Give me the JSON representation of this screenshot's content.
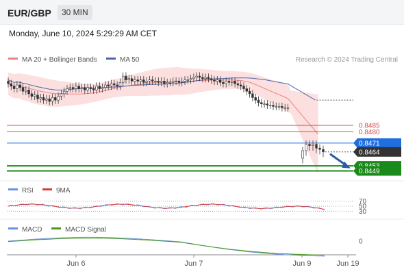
{
  "header": {
    "pair": "EUR/GBP",
    "timeframe": "30 MIN",
    "datetime": "Monday, June 10, 2024 5:29:29 AM CET"
  },
  "legend": {
    "ma20": "MA 20 + Bollinger Bands",
    "ma50": "MA 50",
    "credit": "Research © 2024 Trading Central",
    "rsi": "RSI",
    "rsi_ma": "9MA",
    "macd": "MACD",
    "macd_signal": "MACD Signal"
  },
  "colors": {
    "candle": "#333333",
    "band_fill": "#fbd5d5",
    "ma20": "#f08080",
    "ma50": "#4a66a8",
    "resistance": "#d94a4a",
    "pivot": "#1f6fe0",
    "support": "#1a8a1a",
    "current": "#333333",
    "arrow": "#2a5aa8",
    "rsi": "#6a8fe0",
    "rsi_ma": "#d63b3b",
    "macd": "#6a8fe0",
    "macd_signal": "#4a9a1a"
  },
  "chart_data": {
    "type": "line",
    "x_ticks": [
      "Jun 6",
      "Jun 7",
      "Jun 9",
      "Jun 19"
    ],
    "levels": [
      {
        "label": "0.8485",
        "value": 0.8485,
        "kind": "resistance"
      },
      {
        "label": "0.8480",
        "value": 0.848,
        "kind": "resistance"
      },
      {
        "label": "0.8471",
        "value": 0.8471,
        "kind": "pivot"
      },
      {
        "label": "0.8464",
        "value": 0.8464,
        "kind": "current"
      },
      {
        "label": "0.8453",
        "value": 0.8453,
        "kind": "support"
      },
      {
        "label": "0.8449",
        "value": 0.8449,
        "kind": "support"
      }
    ],
    "ylim": [
      0.8446,
      0.853
    ],
    "close": [
      0.8518,
      0.8516,
      0.8514,
      0.8517,
      0.8515,
      0.8512,
      0.8513,
      0.851,
      0.8508,
      0.8509,
      0.8506,
      0.8507,
      0.8505,
      0.8506,
      0.8504,
      0.8507,
      0.8505,
      0.8508,
      0.851,
      0.8512,
      0.8514,
      0.8515,
      0.8514,
      0.8516,
      0.8514,
      0.8515,
      0.8513,
      0.8515,
      0.8514,
      0.8513,
      0.8516,
      0.8514,
      0.8515,
      0.8517,
      0.8516,
      0.8518,
      0.8517,
      0.8516,
      0.8519,
      0.8524,
      0.8521,
      0.8522,
      0.852,
      0.8521,
      0.852,
      0.8521,
      0.8519,
      0.852,
      0.8521,
      0.852,
      0.852,
      0.8519,
      0.852,
      0.8518,
      0.8519,
      0.8519,
      0.852,
      0.852,
      0.8519,
      0.852,
      0.8521,
      0.8521,
      0.8522,
      0.8523,
      0.8524,
      0.8523,
      0.8522,
      0.8523,
      0.8522,
      0.8521,
      0.852,
      0.8521,
      0.8519,
      0.8518,
      0.852,
      0.8519,
      0.852,
      0.8518,
      0.8517,
      0.8516,
      0.8514,
      0.8512,
      0.851,
      0.8507,
      0.8505,
      0.8503,
      0.8502,
      0.8502,
      0.8501,
      0.8501,
      0.85,
      0.85,
      0.85,
      0.8499,
      0.8499,
      0.8499
    ],
    "close2": [
      0.8465,
      0.847,
      0.8469,
      0.847,
      0.8467,
      0.8466,
      0.8464
    ],
    "ma20_last": 0.8478,
    "ma50_last": 0.8505,
    "rsi_levels": [
      70,
      50,
      30
    ],
    "rsi_value": 37,
    "macd_levels": [
      0
    ]
  }
}
